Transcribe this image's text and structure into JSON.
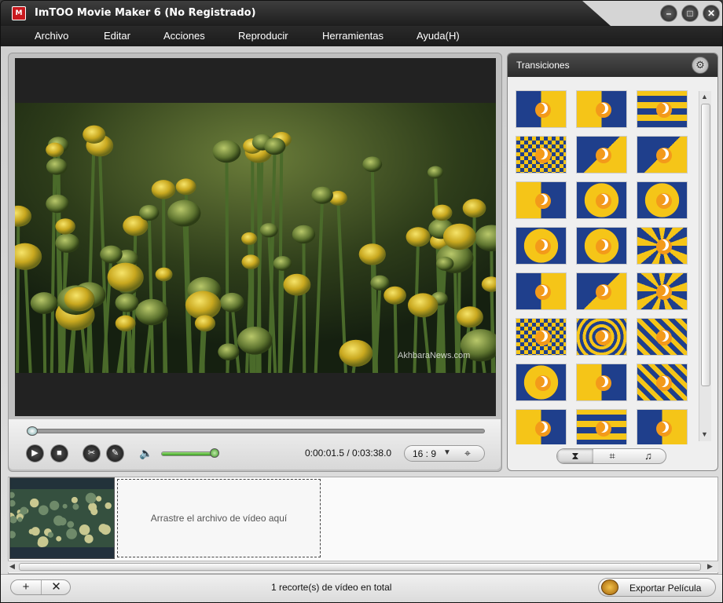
{
  "window": {
    "title": "ImTOO Movie Maker 6 (No Registrado)",
    "app_icon_text": "M"
  },
  "menu": [
    "Archivo",
    "Editar",
    "Acciones",
    "Reproducir",
    "Herramientas",
    "Ayuda(H)"
  ],
  "player": {
    "watermark": "AkhbaraNews.com",
    "seek_progress": 0.007,
    "volume_level": 0.95,
    "time_display": "0:00:01.5 / 0:03:38.0",
    "aspect_ratio": "16 : 9"
  },
  "transitions": {
    "title": "Transiciones",
    "colors": {
      "blue": "#1f3f8c",
      "yellow": "#f5c518",
      "sun": "#f39a1a"
    },
    "tabs": [
      {
        "icon": "transition-icon",
        "glyph": "⧗"
      },
      {
        "icon": "crop-icon",
        "glyph": "⌗"
      },
      {
        "icon": "music-icon",
        "glyph": "♫"
      }
    ]
  },
  "timeline": {
    "drop_placeholder": "Arrastre el archivo de vídeo aquí"
  },
  "status": {
    "summary": "1 recorte(s) de vídeo en total",
    "add_label": "+",
    "remove_label": "✕",
    "export_label": "Exportar Película"
  }
}
